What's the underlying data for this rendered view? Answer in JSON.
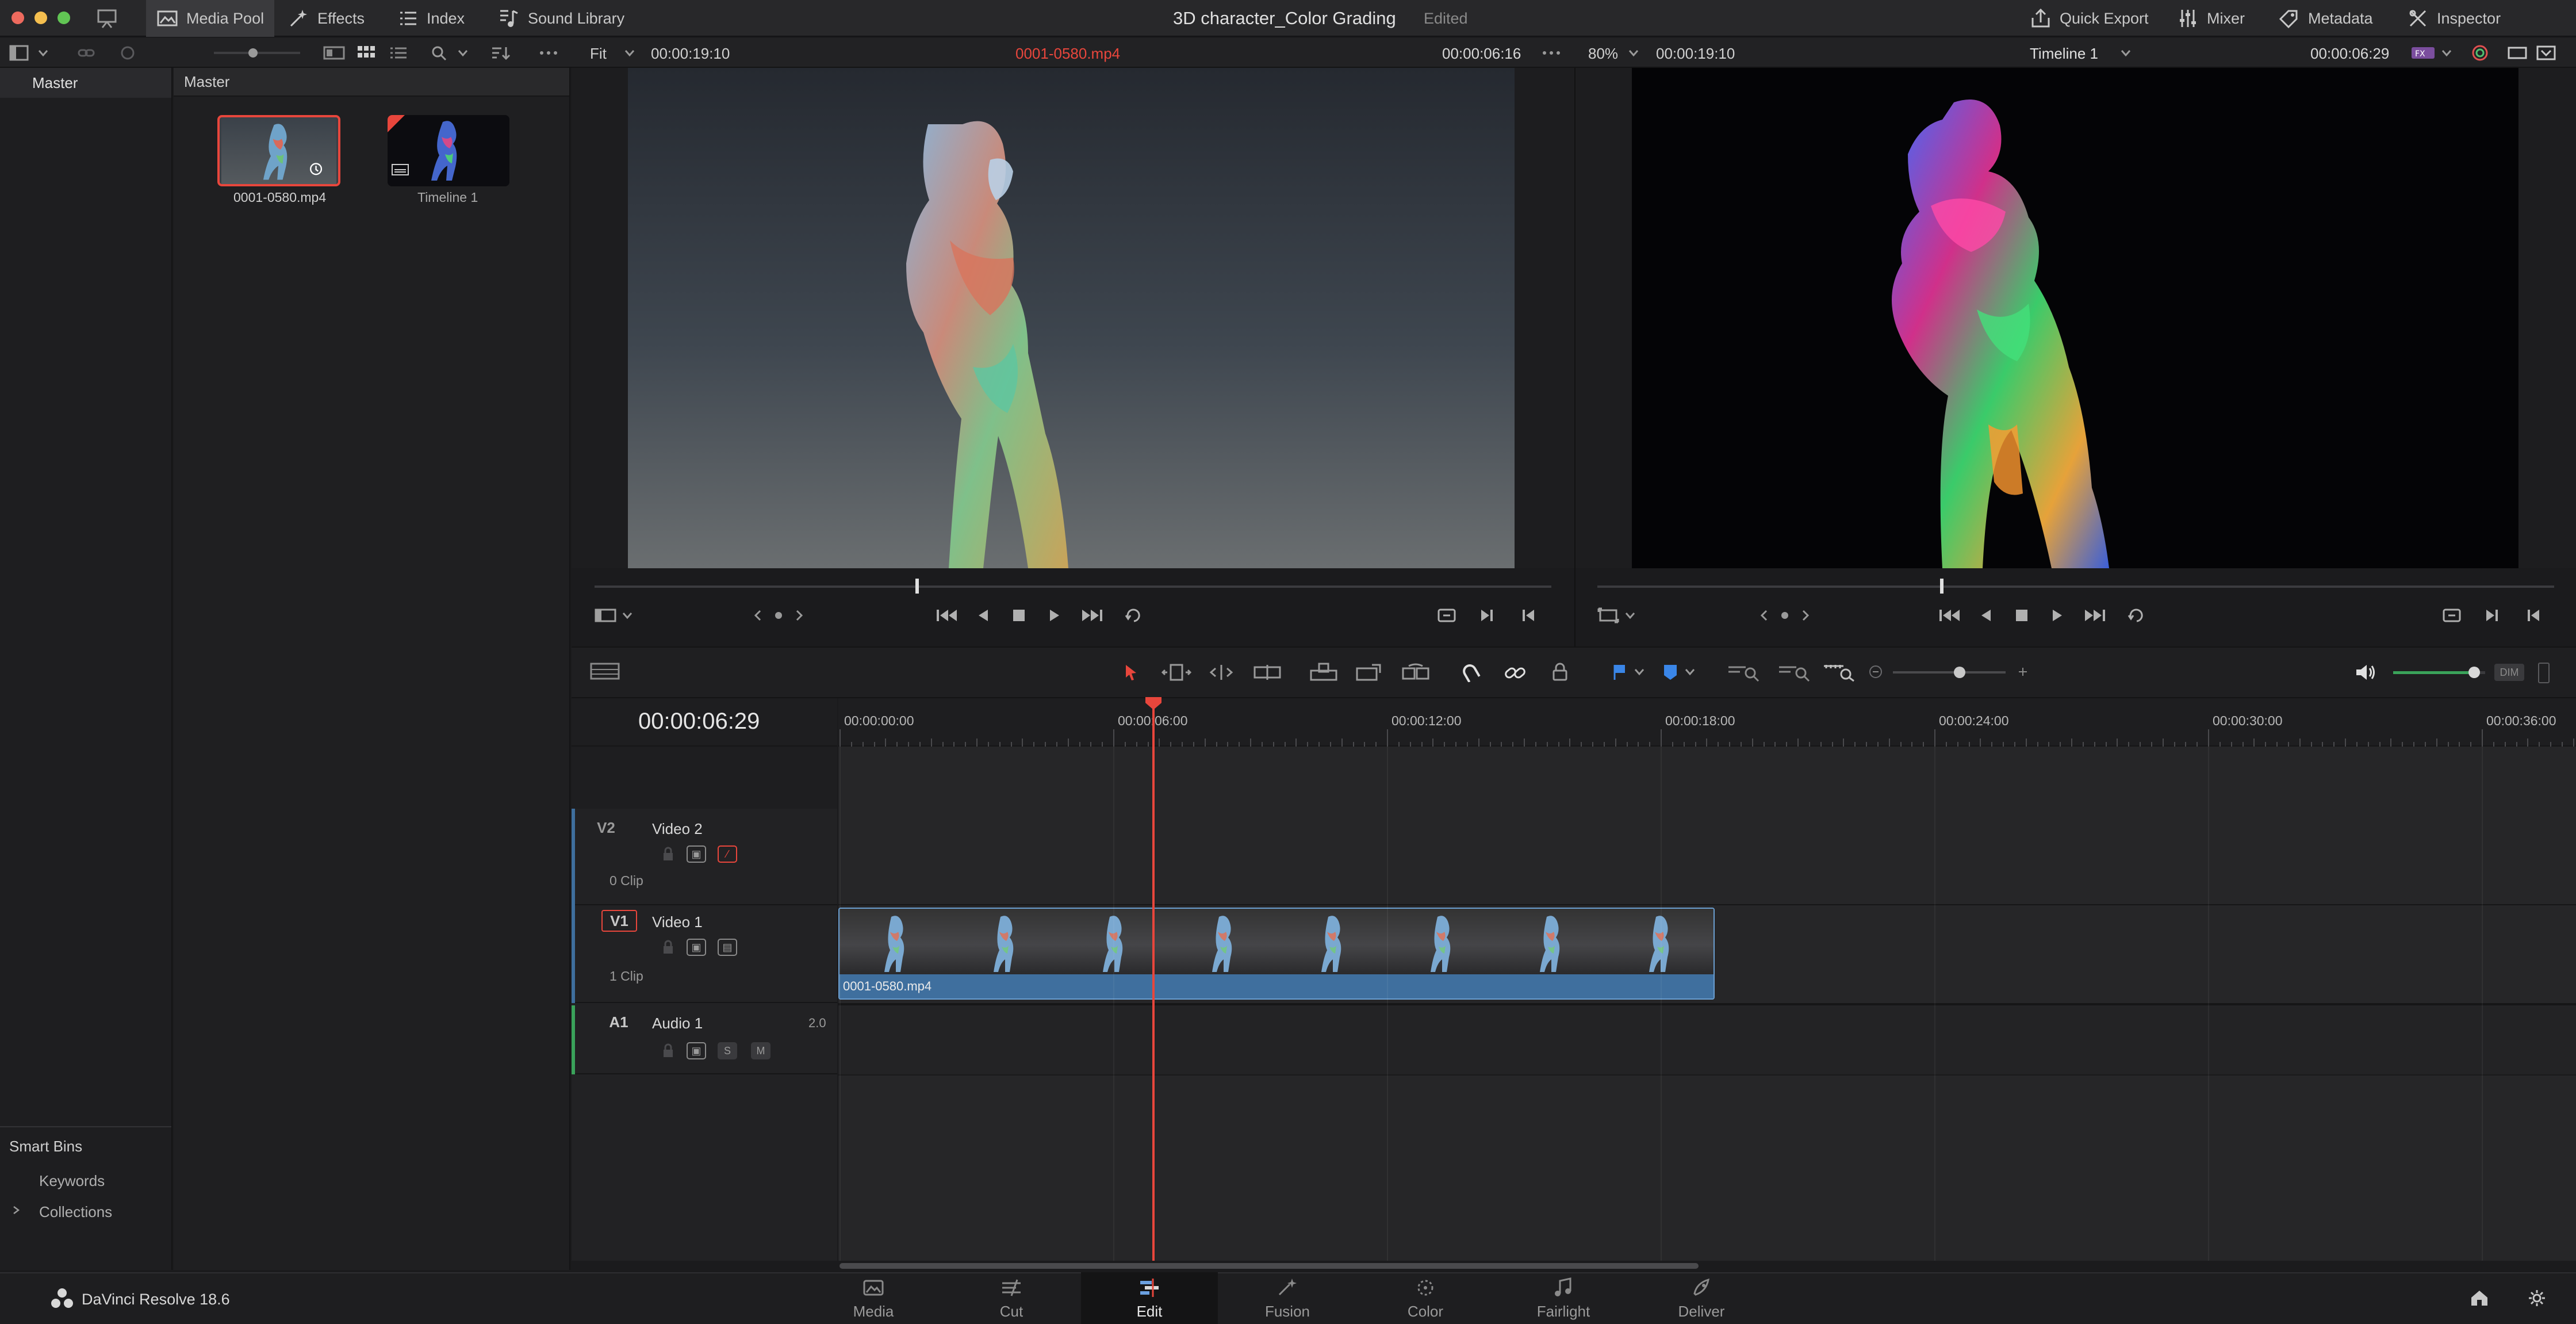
{
  "window": {
    "project_title": "3D character_Color Grading",
    "project_status": "Edited"
  },
  "topbar": {
    "media_pool": "Media Pool",
    "effects": "Effects",
    "index": "Index",
    "sound_library": "Sound Library",
    "quick_export": "Quick Export",
    "mixer": "Mixer",
    "metadata": "Metadata",
    "inspector": "Inspector"
  },
  "bins": {
    "master": "Master",
    "smart_bins_title": "Smart Bins",
    "smart_bins": [
      "Keywords",
      "Collections"
    ]
  },
  "media_pool": {
    "header": "Master",
    "items": [
      {
        "name": "0001-0580.mp4",
        "selected": true
      },
      {
        "name": "Timeline 1",
        "selected": false
      }
    ]
  },
  "source_viewer": {
    "zoom": "Fit",
    "timecode_left": "00:00:19:10",
    "clip_name": "0001-0580.mp4",
    "timecode_right": "00:00:06:16",
    "playhead_fraction": 0.337
  },
  "timeline_viewer": {
    "zoom": "80%",
    "timecode_left": "00:00:19:10",
    "timeline_name": "Timeline 1",
    "timecode_right": "00:00:06:29",
    "playhead_fraction": 0.362
  },
  "timeline": {
    "current_timecode": "00:00:06:29",
    "ruler_labels": [
      "00:00:00:00",
      "00:00:06:00",
      "00:00:12:00",
      "00:00:18:00",
      "00:00:24:00",
      "00:00:30:00",
      "00:00:36:00"
    ],
    "tracks": [
      {
        "id": "V2",
        "name": "Video 2",
        "count": "0 Clip"
      },
      {
        "id": "V1",
        "name": "Video 1",
        "count": "1 Clip"
      },
      {
        "id": "A1",
        "name": "Audio 1",
        "channels": "2.0",
        "solo": "S",
        "mute": "M"
      }
    ],
    "clip_name": "0001-0580.mp4",
    "volume_level": 0.88,
    "dim_label": "DIM"
  },
  "bottom": {
    "app_name": "DaVinci Resolve 18.6",
    "pages": [
      "Media",
      "Cut",
      "Edit",
      "Fusion",
      "Color",
      "Fairlight",
      "Deliver"
    ],
    "active_page": "Edit"
  },
  "colors": {
    "accent_red": "#e8463c",
    "clip_blue": "#3f6f9e",
    "audio_green": "#3aa35a",
    "playhead": "#e8463c"
  }
}
